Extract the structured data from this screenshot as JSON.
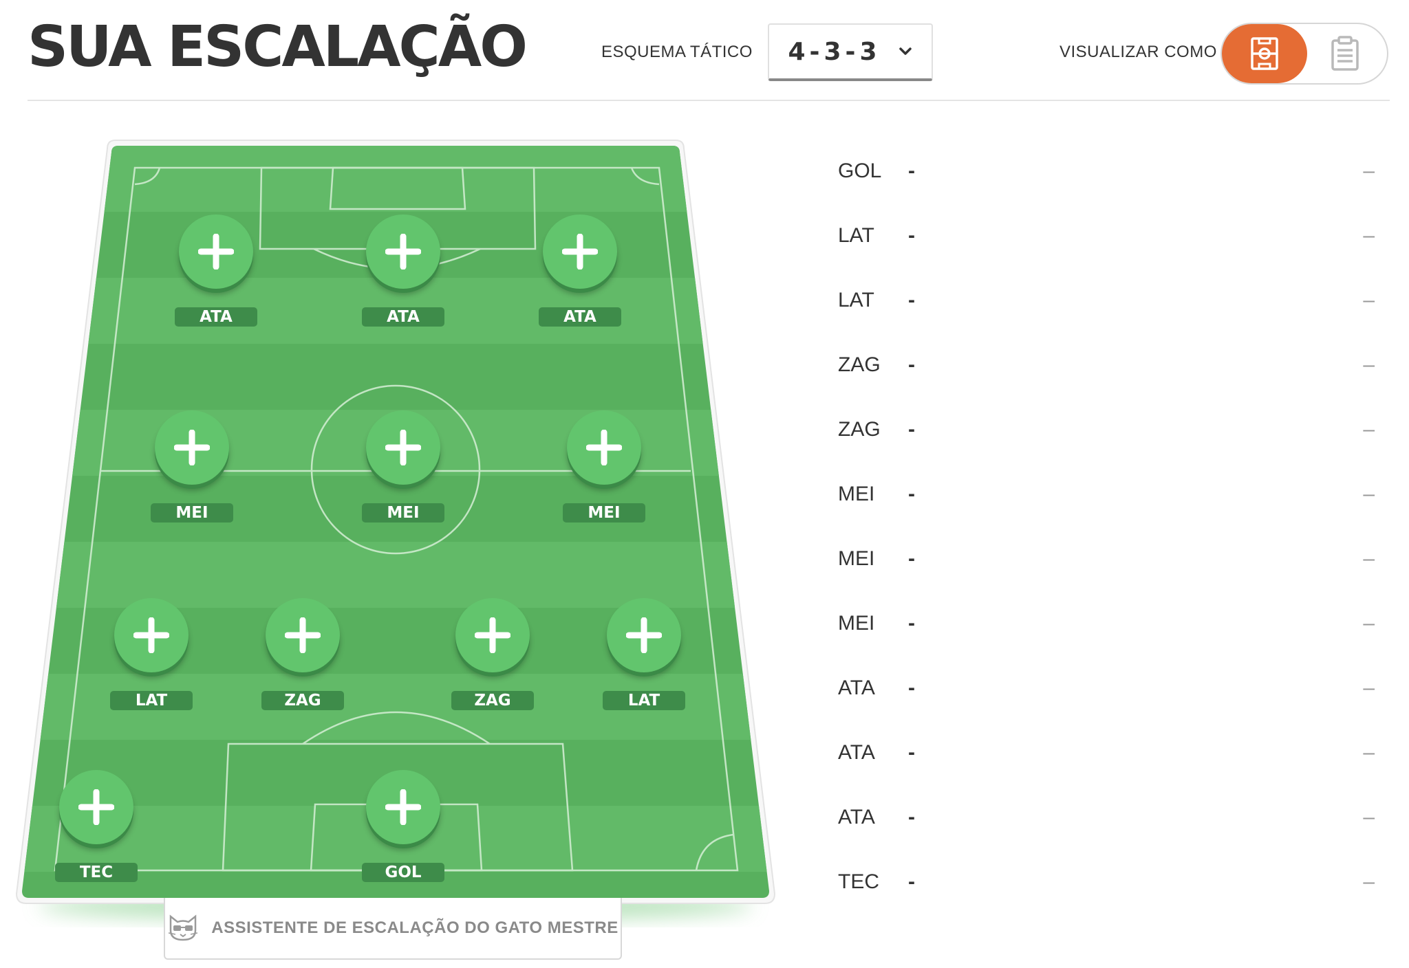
{
  "header": {
    "title": "SUA ESCALAÇÃO",
    "scheme_label": "ESQUEMA TÁTICO",
    "scheme_value": "4-3-3",
    "view_label": "VISUALIZAR COMO",
    "view_options": [
      {
        "icon": "field-view-icon",
        "active": true
      },
      {
        "icon": "clipboard-list-icon",
        "active": false
      }
    ]
  },
  "field": {
    "slots": [
      {
        "label": "ATA"
      },
      {
        "label": "ATA"
      },
      {
        "label": "ATA"
      },
      {
        "label": "MEI"
      },
      {
        "label": "MEI"
      },
      {
        "label": "MEI"
      },
      {
        "label": "LAT"
      },
      {
        "label": "ZAG"
      },
      {
        "label": "ZAG"
      },
      {
        "label": "LAT"
      },
      {
        "label": "TEC"
      },
      {
        "label": "GOL"
      }
    ],
    "assistant_label": "ASSISTENTE DE ESCALAÇÃO DO GATO MESTRE"
  },
  "roster": [
    {
      "pos": "GOL",
      "name": "-",
      "score": "–"
    },
    {
      "pos": "LAT",
      "name": "-",
      "score": "–"
    },
    {
      "pos": "LAT",
      "name": "-",
      "score": "–"
    },
    {
      "pos": "ZAG",
      "name": "-",
      "score": "–"
    },
    {
      "pos": "ZAG",
      "name": "-",
      "score": "–"
    },
    {
      "pos": "MEI",
      "name": "-",
      "score": "–"
    },
    {
      "pos": "MEI",
      "name": "-",
      "score": "–"
    },
    {
      "pos": "MEI",
      "name": "-",
      "score": "–"
    },
    {
      "pos": "ATA",
      "name": "-",
      "score": "–"
    },
    {
      "pos": "ATA",
      "name": "-",
      "score": "–"
    },
    {
      "pos": "ATA",
      "name": "-",
      "score": "–"
    },
    {
      "pos": "TEC",
      "name": "-",
      "score": "–"
    }
  ],
  "colors": {
    "accent": "#e56c34",
    "pitch": "#59b15f",
    "pitch_stripe": "#62bb68",
    "slot_button": "#62c56d",
    "slot_label_bg": "#3e8c4a"
  }
}
